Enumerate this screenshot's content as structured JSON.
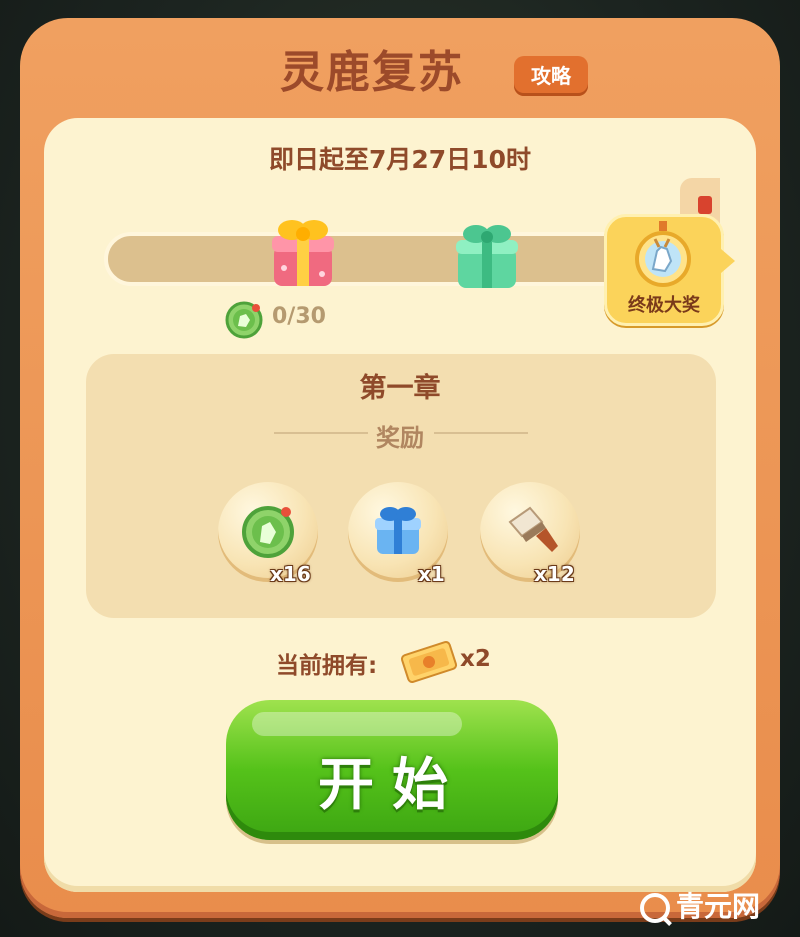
{
  "header": {
    "title": "灵鹿复苏",
    "guide_button": "攻略"
  },
  "event": {
    "date_range": "即日起至7月27日10时"
  },
  "progress": {
    "current": 0,
    "total": 30,
    "count_label": "0/30",
    "milestones": [
      "pink-gift-box-icon",
      "green-gift-box-icon"
    ],
    "grand_prize_label": "终极大奖"
  },
  "chapter": {
    "title": "第一章",
    "rewards_label": "奖励",
    "rewards": [
      {
        "icon": "deer-coin-icon",
        "qty": "x16"
      },
      {
        "icon": "blue-gift-box-icon",
        "qty": "x1"
      },
      {
        "icon": "brush-icon",
        "qty": "x12"
      }
    ]
  },
  "inventory": {
    "label": "当前拥有:",
    "ticket_icon": "ticket-icon",
    "count": "x2"
  },
  "actions": {
    "start_label": "开始"
  },
  "watermark": {
    "text": "青元网"
  },
  "colors": {
    "panel": "#e98d4c",
    "card": "#fdf3d0",
    "title": "#9c4a2a",
    "start_button": "#55c21a",
    "grand_prize": "#fbd35a"
  }
}
